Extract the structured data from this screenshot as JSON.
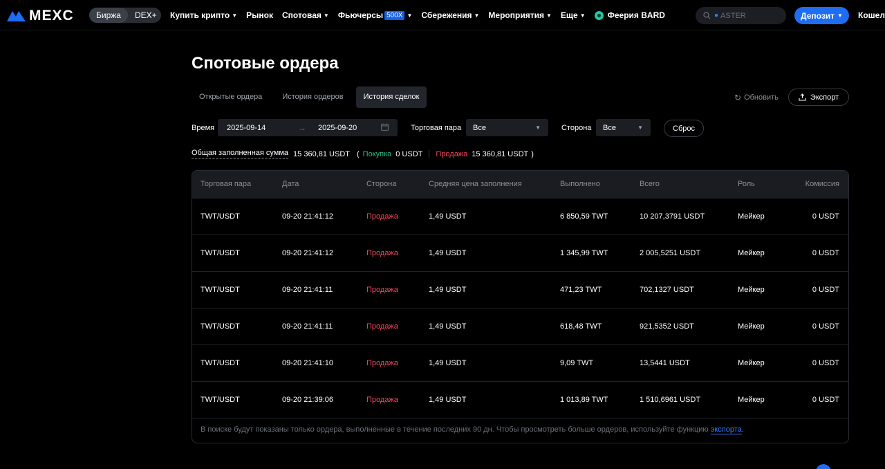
{
  "header": {
    "logo_text": "MEXC",
    "switch": [
      "Биржа",
      "DEX+"
    ],
    "nav": [
      {
        "label": "Купить крипто",
        "caret": true
      },
      {
        "label": "Рынок",
        "caret": false
      },
      {
        "label": "Спотовая",
        "caret": true
      },
      {
        "label": "Фьючерсы",
        "badge": "500X",
        "caret": true
      },
      {
        "label": "Сбережения",
        "caret": true
      },
      {
        "label": "Мероприятия",
        "caret": true
      },
      {
        "label": "Еще",
        "caret": true
      }
    ],
    "promo": "Феерия BARD",
    "search_placeholder": "ASTER",
    "deposit_label": "Депозит",
    "wallet_label": "Кошелек"
  },
  "page": {
    "title": "Спотовые ордера",
    "tabs": [
      "Открытые ордера",
      "История ордеров",
      "История сделок"
    ],
    "active_tab": 2,
    "refresh_label": "Обновить",
    "export_label": "Экспорт"
  },
  "filters": {
    "time_label": "Время",
    "date_from": "2025-09-14",
    "date_to": "2025-09-20",
    "pair_label": "Торговая пара",
    "pair_value": "Все",
    "side_label": "Сторона",
    "side_value": "Все",
    "reset_label": "Сброс"
  },
  "summary": {
    "label": "Общая заполненная сумма",
    "total": "15 360,81 USDT",
    "buy_label": "Покупка",
    "buy_value": "0 USDT",
    "sell_label": "Продажа",
    "sell_value": "15 360,81 USDT"
  },
  "table": {
    "columns": [
      "Торговая пара",
      "Дата",
      "Сторона",
      "Средняя цена заполнения",
      "Выполнено",
      "Всего",
      "Роль",
      "Комиссия"
    ],
    "rows": [
      [
        "TWT/USDT",
        "09-20 21:41:12",
        "Продажа",
        "1,49 USDT",
        "6 850,59 TWT",
        "10 207,3791 USDT",
        "Мейкер",
        "0 USDT"
      ],
      [
        "TWT/USDT",
        "09-20 21:41:12",
        "Продажа",
        "1,49 USDT",
        "1 345,99 TWT",
        "2 005,5251 USDT",
        "Мейкер",
        "0 USDT"
      ],
      [
        "TWT/USDT",
        "09-20 21:41:11",
        "Продажа",
        "1,49 USDT",
        "471,23 TWT",
        "702,1327 USDT",
        "Мейкер",
        "0 USDT"
      ],
      [
        "TWT/USDT",
        "09-20 21:41:11",
        "Продажа",
        "1,49 USDT",
        "618,48 TWT",
        "921,5352 USDT",
        "Мейкер",
        "0 USDT"
      ],
      [
        "TWT/USDT",
        "09-20 21:41:10",
        "Продажа",
        "1,49 USDT",
        "9,09 TWT",
        "13,5441 USDT",
        "Мейкер",
        "0 USDT"
      ],
      [
        "TWT/USDT",
        "09-20 21:39:06",
        "Продажа",
        "1,49 USDT",
        "1 013,89 TWT",
        "1 510,6961 USDT",
        "Мейкер",
        "0 USDT"
      ]
    ],
    "note_text": "В поиске будут показаны только ордера, выполненные в течение последних 90 дн. Чтобы просмотреть больше ордеров, используйте функцию ",
    "note_link": "экспорта",
    "note_end": "."
  },
  "colors": {
    "accent": "#1e6df2",
    "buy": "#2ebd85",
    "sell": "#f6465d"
  }
}
